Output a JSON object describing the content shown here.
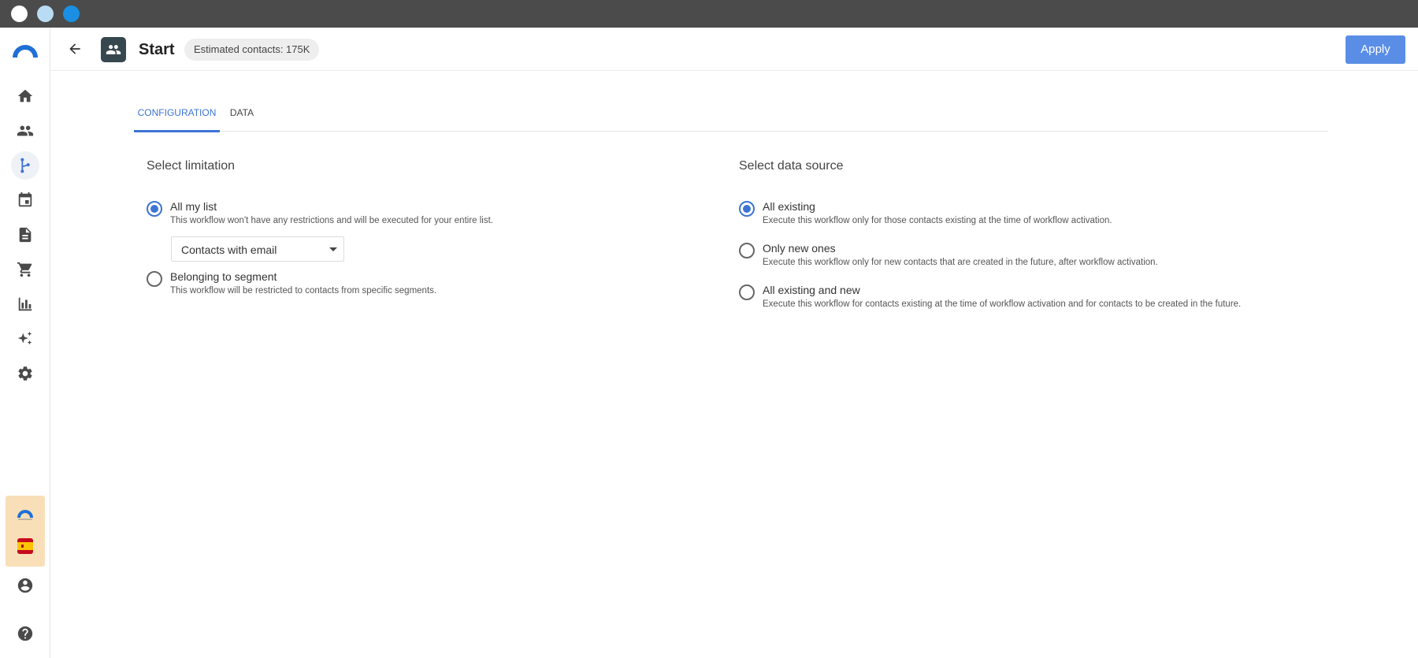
{
  "header": {
    "title": "Start",
    "estimated_contacts": "Estimated contacts: 175K",
    "apply_label": "Apply"
  },
  "sidebar": {
    "items": [
      {
        "name": "home",
        "icon": "home-icon"
      },
      {
        "name": "contacts",
        "icon": "people-icon"
      },
      {
        "name": "workflows",
        "icon": "workflow-icon",
        "active": true
      },
      {
        "name": "calendar",
        "icon": "calendar-icon"
      },
      {
        "name": "content",
        "icon": "document-icon"
      },
      {
        "name": "ecommerce",
        "icon": "cart-icon"
      },
      {
        "name": "reports",
        "icon": "bar-chart-icon"
      },
      {
        "name": "ai",
        "icon": "sparkle-icon"
      },
      {
        "name": "settings",
        "icon": "gear-icon"
      }
    ],
    "bottom": [
      {
        "name": "account",
        "icon": "account-circle-icon"
      },
      {
        "name": "help",
        "icon": "help-icon"
      }
    ]
  },
  "tabs": [
    {
      "label": "CONFIGURATION",
      "active": true
    },
    {
      "label": "DATA",
      "active": false
    }
  ],
  "limitation": {
    "title": "Select limitation",
    "options": [
      {
        "label": "All my list",
        "description": "This workflow won't have any restrictions and will be executed for your entire list.",
        "checked": true
      },
      {
        "label": "Belonging to segment",
        "description": "This workflow will be restricted to contacts from specific segments.",
        "checked": false
      }
    ],
    "dropdown_value": "Contacts with email"
  },
  "data_source": {
    "title": "Select data source",
    "options": [
      {
        "label": "All existing",
        "description": "Execute this workflow only for those contacts existing at the time of workflow activation.",
        "checked": true
      },
      {
        "label": "Only new ones",
        "description": "Execute this workflow only for new contacts that are created in the future, after workflow activation.",
        "checked": false
      },
      {
        "label": "All existing and new",
        "description": "Execute this workflow for contacts existing at the time of workflow activation and for contacts to be created in the future.",
        "checked": false
      }
    ]
  },
  "colors": {
    "accent": "#3d74d4",
    "apply_button": "#5a8ee6",
    "titlebar": "#4b4b4b",
    "promo_bg": "#f8dfb8"
  }
}
